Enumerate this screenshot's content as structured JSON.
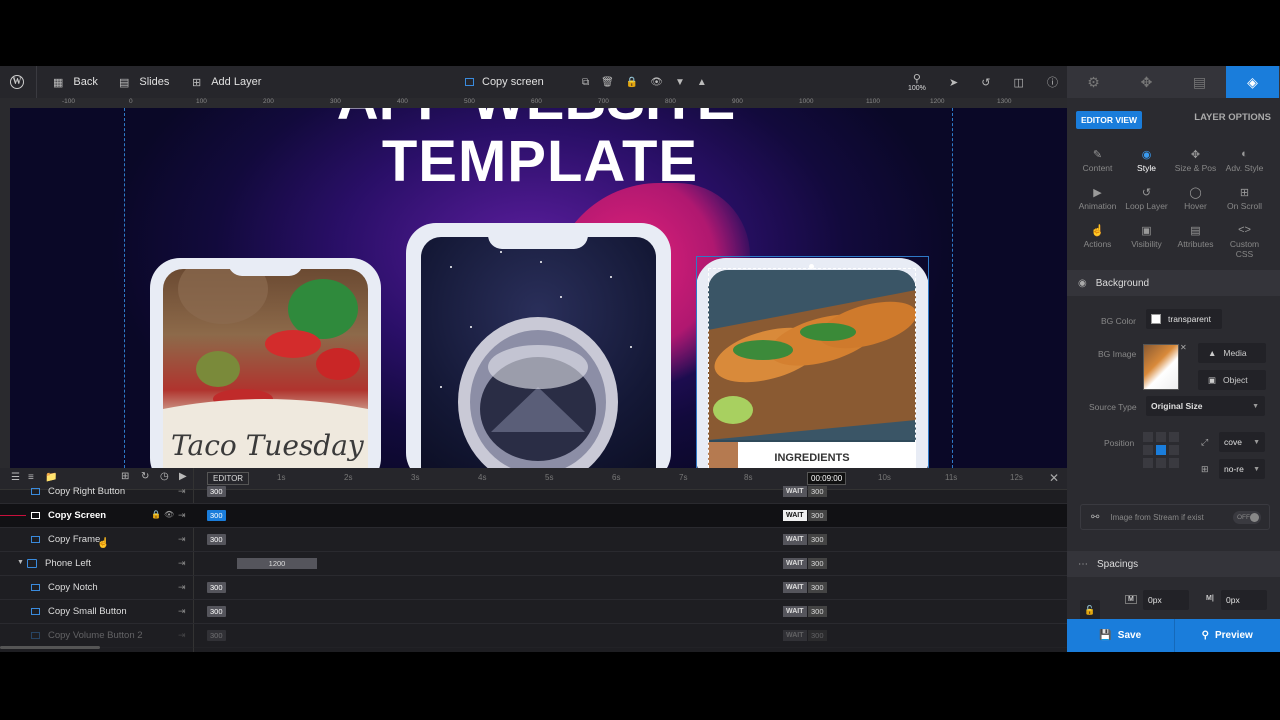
{
  "toolbar": {
    "back_label": "Back",
    "slides_label": "Slides",
    "add_layer_label": "Add Layer",
    "selected_layer_label": "Copy  screen",
    "zoom_level": "100%"
  },
  "ruler": {
    "ticks": [
      "-100",
      "0",
      "100",
      "200",
      "300",
      "400",
      "500",
      "600",
      "700",
      "800",
      "900",
      "1000",
      "1100",
      "1200",
      "1300"
    ]
  },
  "canvas": {
    "title_line2": "TEMPLATE",
    "title_line1": "APP WEBSITE",
    "card_left_text": "Taco Tuesday",
    "card_right_heading": "INGREDIENTS"
  },
  "right_panel": {
    "editor_view_label": "EDITOR VIEW",
    "layer_options_label": "LAYER OPTIONS",
    "grid_items": [
      {
        "label": "Content",
        "icon": "pencil-icon"
      },
      {
        "label": "Style",
        "icon": "palette-icon"
      },
      {
        "label": "Size & Pos",
        "icon": "move-icon"
      },
      {
        "label": "Adv. Style",
        "icon": "drop-icon"
      },
      {
        "label": "Animation",
        "icon": "play-icon"
      },
      {
        "label": "Loop Layer",
        "icon": "loop-icon"
      },
      {
        "label": "Hover",
        "icon": "mouse-icon"
      },
      {
        "label": "On Scroll",
        "icon": "scroll-icon"
      },
      {
        "label": "Actions",
        "icon": "hand-icon"
      },
      {
        "label": "Visibility",
        "icon": "visibility-icon"
      },
      {
        "label": "Attributes",
        "icon": "attributes-icon"
      },
      {
        "label": "Custom CSS",
        "icon": "code-icon"
      }
    ],
    "background_section": "Background",
    "bg_color_label": "BG Color",
    "bg_color_value": "transparent",
    "bg_image_label": "BG Image",
    "media_label": "Media",
    "object_label": "Object",
    "source_type_label": "Source Type",
    "source_type_value": "Original Size",
    "position_label": "Position",
    "position_cover": "cove",
    "position_repeat": "no-re",
    "stream_label": "Image from Stream if exist",
    "stream_toggle": "OFF",
    "spacings_section": "Spacings",
    "margin_label": "M",
    "margin_value": "0px",
    "padding_label": "M|",
    "padding_value": "0px",
    "save_label": "Save",
    "preview_label": "Preview"
  },
  "timeline": {
    "editor_label": "EDITOR",
    "current_time": "00:09:00",
    "ticks": [
      "1s",
      "2s",
      "3s",
      "4s",
      "5s",
      "6s",
      "7s",
      "8s",
      "9s",
      "10s",
      "11s",
      "12s"
    ],
    "rows": [
      {
        "name": "Copy Right Button",
        "start": "300",
        "wait": "WAIT",
        "wait_value": "300"
      },
      {
        "name": "Copy Screen",
        "start": "300",
        "wait": "WAIT",
        "wait_value": "300"
      },
      {
        "name": "Copy Frame",
        "start": "300",
        "wait": "WAIT",
        "wait_value": "300"
      },
      {
        "name": "Phone Left",
        "start": "1200",
        "wait": "WAIT",
        "wait_value": "300"
      },
      {
        "name": "Copy Notch",
        "start": "300",
        "wait": "WAIT",
        "wait_value": "300"
      },
      {
        "name": "Copy Small Button",
        "start": "300",
        "wait": "WAIT",
        "wait_value": "300"
      },
      {
        "name": "Copy Volume Button 2",
        "start": "300",
        "wait": "WAIT",
        "wait_value": "300"
      }
    ]
  }
}
